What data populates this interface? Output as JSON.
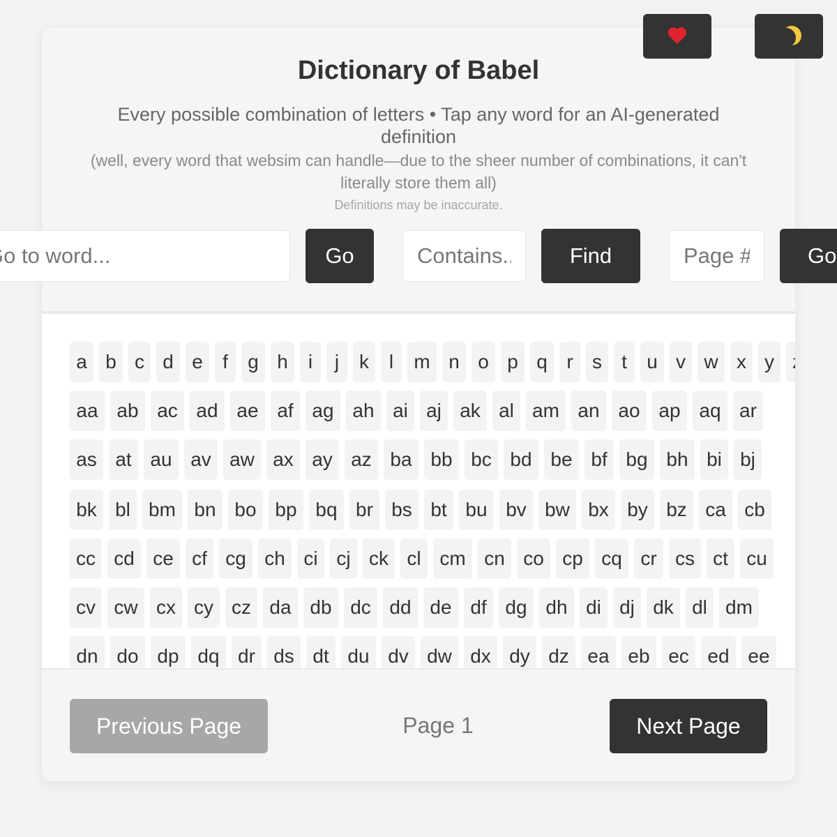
{
  "header": {
    "title": "Dictionary of Babel",
    "subtitle": "Every possible combination of letters • Tap any word for an AI-generated definition",
    "note": "(well, every word that websim can handle—due to the sheer number of combinations, it can't literally store them all)",
    "disclaimer": "Definitions may be inaccurate.",
    "favorite_icon": "heart-icon",
    "theme_icon": "moon-icon"
  },
  "search": {
    "goto_placeholder": "Go to word...",
    "goto_button": "Go",
    "contains_placeholder": "Contains...",
    "find_button": "Find",
    "page_placeholder": "Page #",
    "page_go_button": "Go"
  },
  "words": [
    [
      "a",
      "b",
      "c",
      "d",
      "e",
      "f",
      "g",
      "h",
      "i",
      "j",
      "k",
      "l",
      "m",
      "n",
      "o",
      "p",
      "q",
      "r",
      "s",
      "t",
      "u",
      "v",
      "w",
      "x",
      "y",
      "z"
    ],
    [
      "aa",
      "ab",
      "ac",
      "ad",
      "ae",
      "af",
      "ag",
      "ah",
      "ai",
      "aj",
      "ak",
      "al",
      "am",
      "an",
      "ao",
      "ap",
      "aq",
      "ar"
    ],
    [
      "as",
      "at",
      "au",
      "av",
      "aw",
      "ax",
      "ay",
      "az",
      "ba",
      "bb",
      "bc",
      "bd",
      "be",
      "bf",
      "bg",
      "bh",
      "bi",
      "bj"
    ],
    [
      "bk",
      "bl",
      "bm",
      "bn",
      "bo",
      "bp",
      "bq",
      "br",
      "bs",
      "bt",
      "bu",
      "bv",
      "bw",
      "bx",
      "by",
      "bz",
      "ca",
      "cb"
    ],
    [
      "cc",
      "cd",
      "ce",
      "cf",
      "cg",
      "ch",
      "ci",
      "cj",
      "ck",
      "cl",
      "cm",
      "cn",
      "co",
      "cp",
      "cq",
      "cr",
      "cs",
      "ct",
      "cu"
    ],
    [
      "cv",
      "cw",
      "cx",
      "cy",
      "cz",
      "da",
      "db",
      "dc",
      "dd",
      "de",
      "df",
      "dg",
      "dh",
      "di",
      "dj",
      "dk",
      "dl",
      "dm"
    ],
    [
      "dn",
      "do",
      "dp",
      "dq",
      "dr",
      "ds",
      "dt",
      "du",
      "dv",
      "dw",
      "dx",
      "dy",
      "dz",
      "ea",
      "eb",
      "ec",
      "ed",
      "ee"
    ]
  ],
  "pagination": {
    "prev_label": "Previous Page",
    "page_label": "Page 1",
    "next_label": "Next Page"
  }
}
